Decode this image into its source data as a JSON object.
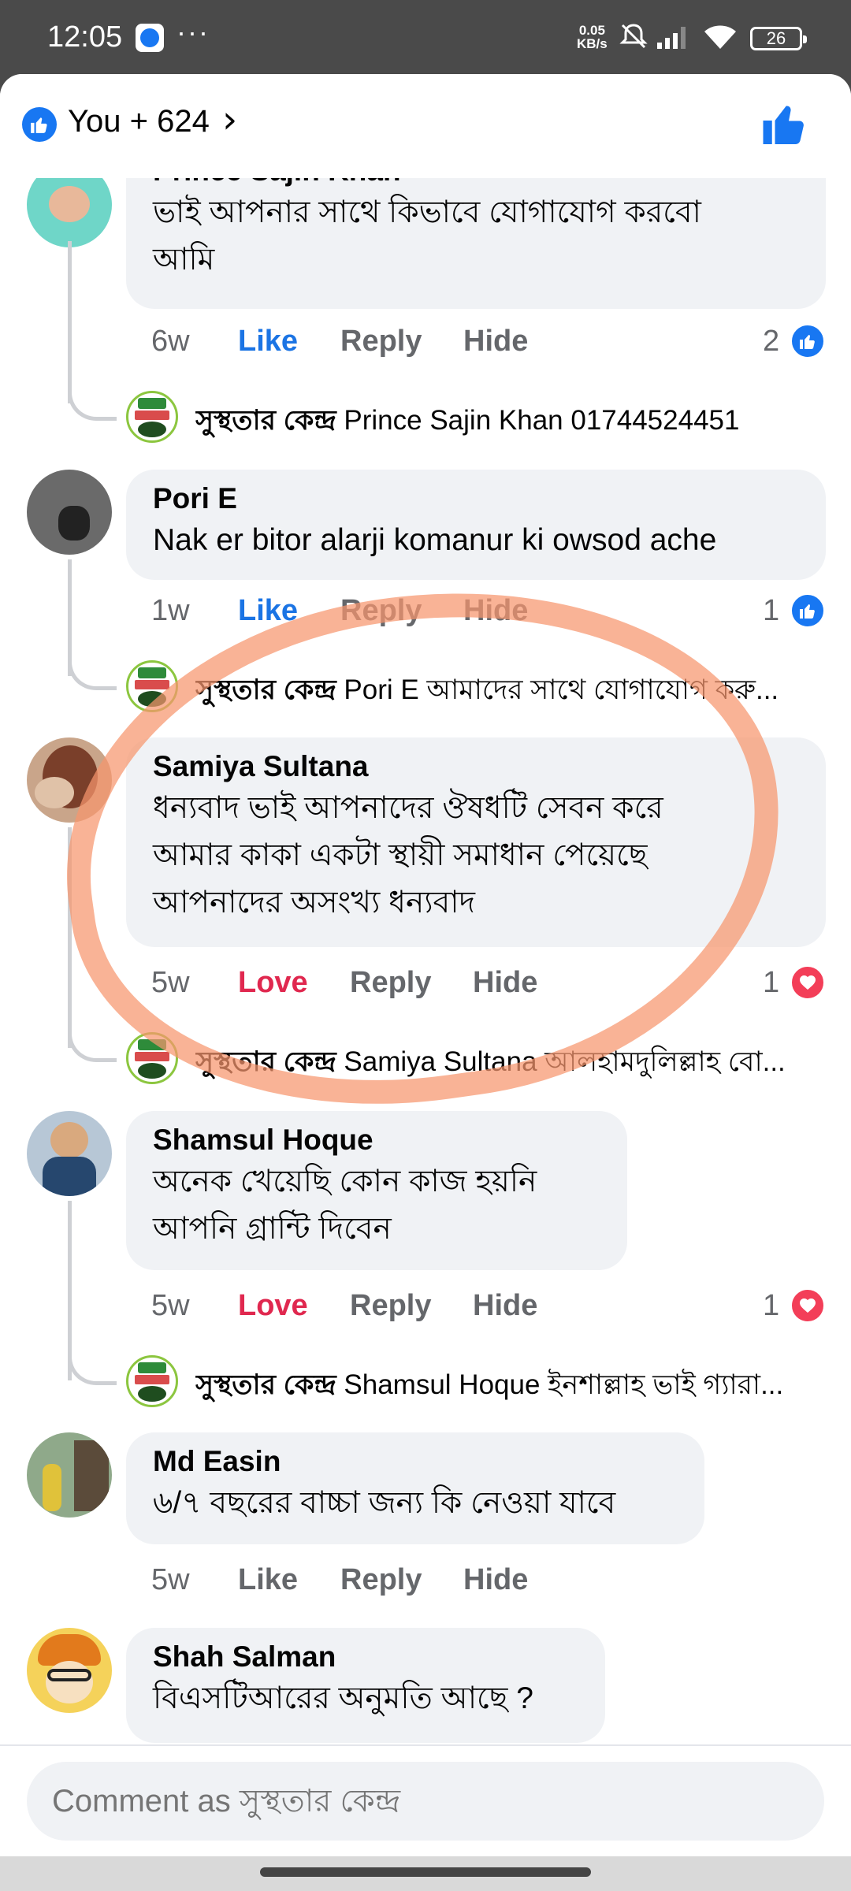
{
  "status_bar": {
    "time": "12:05",
    "more": "···",
    "net_speed_value": "0.05",
    "net_speed_unit": "KB/s",
    "battery": "26"
  },
  "header": {
    "reactions_label": "You + 624",
    "icons": [
      "like-icon",
      "chevron-right-icon",
      "thumbs-up-icon"
    ]
  },
  "comments": [
    {
      "name": "Prince Sajin Khan",
      "text_lines": [
        "ভাই আপনার সাথে কিভাবে যোগাযোগ করবো",
        "আমি"
      ],
      "time": "6w",
      "reaction_label": "Like",
      "reply_label": "Reply",
      "hide_label": "Hide",
      "reaction_count": "2",
      "reaction_type": "like",
      "reply": {
        "author": "সুস্থতার কেন্দ্র",
        "text": "Prince Sajin Khan 01744524451"
      }
    },
    {
      "name": "Pori E",
      "text_lines": [
        "Nak er bitor alarji  komanur ki owsod ache"
      ],
      "time": "1w",
      "reaction_label": "Like",
      "reply_label": "Reply",
      "hide_label": "Hide",
      "reaction_count": "1",
      "reaction_type": "like",
      "reply": {
        "author": "সুস্থতার কেন্দ্র",
        "text": "Pori E আমাদের সাথে যোগাযোগ করু..."
      }
    },
    {
      "name": "Samiya Sultana",
      "text_lines": [
        "ধন্যবাদ ভাই আপনাদের ঔষধটি সেবন করে",
        "আমার কাকা একটা স্থায়ী সমাধান পেয়েছে",
        "আপনাদের অসংখ্য ধন্যবাদ"
      ],
      "time": "5w",
      "reaction_label": "Love",
      "reply_label": "Reply",
      "hide_label": "Hide",
      "reaction_count": "1",
      "reaction_type": "love",
      "reply": {
        "author": "সুস্থতার কেন্দ্র",
        "text": "Samiya Sultana আলহামদুলিল্লাহ বো..."
      }
    },
    {
      "name": "Shamsul Hoque",
      "text_lines": [
        "অনেক খেয়েছি কোন কাজ হয়নি",
        "আপনি গ্রান্টি দিবেন"
      ],
      "time": "5w",
      "reaction_label": "Love",
      "reply_label": "Reply",
      "hide_label": "Hide",
      "reaction_count": "1",
      "reaction_type": "love",
      "reply": {
        "author": "সুস্থতার কেন্দ্র",
        "text": "Shamsul Hoque ইনশাল্লাহ ভাই গ্যারা..."
      }
    },
    {
      "name": "Md Easin",
      "text_lines": [
        "৬/৭ বছরের বাচ্চা জন্য কি নেওয়া যাবে"
      ],
      "time": "5w",
      "reaction_label": "Like",
      "reply_label": "Reply",
      "hide_label": "Hide"
    },
    {
      "name": "Shah Salman",
      "text_lines": [
        "বিএসটিআরের অনুমতি আছে ?"
      ]
    }
  ],
  "composer": {
    "placeholder": "Comment as সুস্থতার কেন্দ্র"
  },
  "colors": {
    "facebook_blue": "#1877f2",
    "love_red": "#f33e58",
    "annotation_orange": "#f7966e"
  }
}
